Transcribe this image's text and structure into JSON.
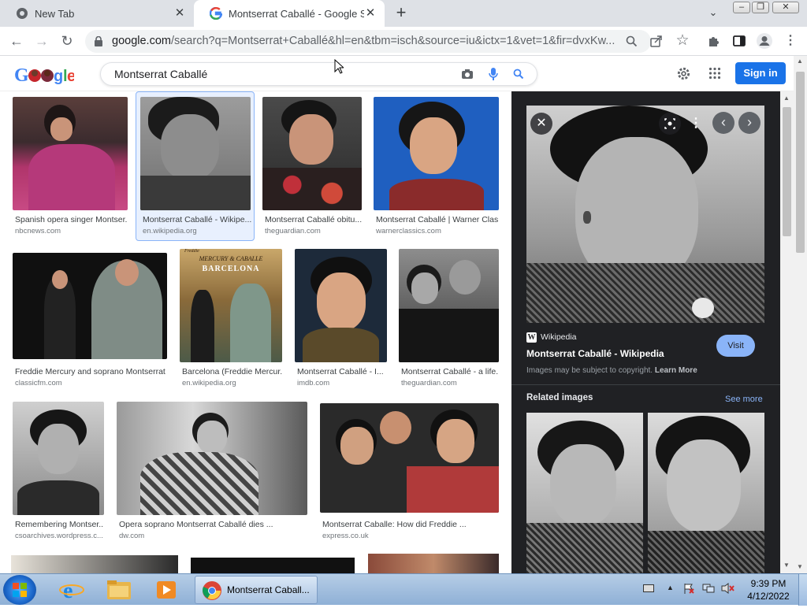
{
  "browser": {
    "tabs": [
      {
        "title": "New Tab"
      },
      {
        "title": "Montserrat Caballé - Google Sea"
      }
    ],
    "new_tab_icon": "plus-icon",
    "url_host": "google.com",
    "url_path": "/search?q=Montserrat+Caballé&hl=en&tbm=isch&source=iu&ictx=1&vet=1&fir=dvxKw..."
  },
  "google": {
    "search_value": "Montserrat Caballé",
    "sign_in_label": "Sign in"
  },
  "results": [
    {
      "caption": "Spanish opera singer Montser...",
      "source": "nbcnews.com"
    },
    {
      "caption": "Montserrat Caballé - Wikipe...",
      "source": "en.wikipedia.org"
    },
    {
      "caption": "Montserrat Caballé obitu...",
      "source": "theguardian.com"
    },
    {
      "caption": "Montserrat Caballé | Warner Clas...",
      "source": "warnerclassics.com"
    },
    {
      "caption": "Freddie Mercury and soprano Montserrat ...",
      "source": "classicfm.com"
    },
    {
      "caption": "Barcelona (Freddie Mercur...",
      "source": "en.wikipedia.org"
    },
    {
      "caption": "Montserrat Caballé - I...",
      "source": "imdb.com"
    },
    {
      "caption": "Montserrat Caballé - a life...",
      "source": "theguardian.com"
    },
    {
      "caption": "Remembering Montser...",
      "source": "csoarchives.wordpress.c..."
    },
    {
      "caption": "Opera soprano Montserrat Caballé dies ...",
      "source": "dw.com"
    },
    {
      "caption": "Montserrat Caballe: How did Freddie ...",
      "source": "express.co.uk"
    }
  ],
  "album_text": {
    "line1": "Freddie",
    "line2": "MERCURY & CABALLE",
    "line3": "BARCELONA"
  },
  "panel": {
    "source_name": "Wikipedia",
    "title": "Montserrat Caballé - Wikipedia",
    "visit_label": "Visit",
    "copyright_note": "Images may be subject to copyright.",
    "learn_more": "Learn More",
    "related_heading": "Related images",
    "see_more": "See more"
  },
  "taskbar": {
    "active_task": "Montserrat Caball...",
    "time": "9:39 PM",
    "date": "4/12/2022"
  }
}
